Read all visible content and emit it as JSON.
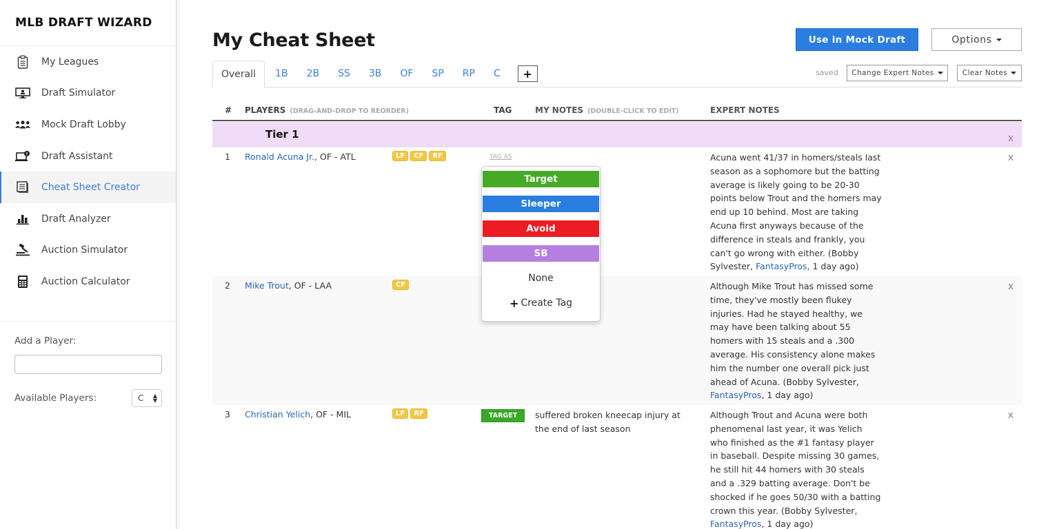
{
  "app": {
    "title": "MLB DRAFT WIZARD"
  },
  "sidebar": {
    "items": [
      {
        "label": "My Leagues",
        "icon": "clipboard-icon",
        "active": false
      },
      {
        "label": "Draft Simulator",
        "icon": "monitor-user-icon",
        "active": false
      },
      {
        "label": "Mock Draft Lobby",
        "icon": "users-group-icon",
        "active": false
      },
      {
        "label": "Draft Assistant",
        "icon": "laptop-alert-icon",
        "active": false
      },
      {
        "label": "Cheat Sheet Creator",
        "icon": "document-list-icon",
        "active": true
      },
      {
        "label": "Draft Analyzer",
        "icon": "bar-chart-icon",
        "active": false
      },
      {
        "label": "Auction Simulator",
        "icon": "gavel-icon",
        "active": false
      },
      {
        "label": "Auction Calculator",
        "icon": "calculator-icon",
        "active": false
      }
    ],
    "add_player_label": "Add a Player:",
    "add_player_value": "",
    "available_players_label": "Available Players:",
    "available_players_selected": "C"
  },
  "header": {
    "title": "My Cheat Sheet",
    "use_in_mock_label": "Use in Mock Draft",
    "options_label": "Options",
    "saved_status": "saved",
    "change_expert_notes_label": "Change Expert Notes",
    "clear_notes_label": "Clear Notes"
  },
  "tabs": [
    {
      "label": "Overall",
      "active": true
    },
    {
      "label": "1B"
    },
    {
      "label": "2B"
    },
    {
      "label": "SS"
    },
    {
      "label": "3B"
    },
    {
      "label": "OF"
    },
    {
      "label": "SP"
    },
    {
      "label": "RP"
    },
    {
      "label": "C"
    }
  ],
  "tab_add_label": "+",
  "table": {
    "columns": {
      "num": "#",
      "players": "PLAYERS",
      "players_hint": "(DRAG-AND-DROP TO REORDER)",
      "tag": "TAG",
      "my_notes": "MY NOTES",
      "my_notes_hint": "(DOUBLE-CLICK TO EDIT)",
      "expert_notes": "EXPERT NOTES"
    },
    "tier": {
      "label": "Tier 1",
      "remove": "x"
    },
    "rows": [
      {
        "rank": "1",
        "name": "Ronald Acuna Jr.",
        "info": ", OF - ATL",
        "positions": [
          "LF",
          "CF",
          "RF"
        ],
        "tag": "TAG AS",
        "my_notes": "",
        "expert_text": "Acuna went 41/37 in homers/steals last season as a sophomore but the batting average is likely going to be 20-30 points below Trout and the homers may end up 10 behind. Most are taking Acuna first anyways because of the difference in steals and frankly, you can't go wrong with either. (Bobby Sylvester, ",
        "expert_source": "FantasyPros",
        "expert_suffix": ", 1 day ago)",
        "remove": "x"
      },
      {
        "rank": "2",
        "name": "Mike Trout",
        "info": ", OF - LAA",
        "positions": [
          "CF"
        ],
        "tag": "",
        "my_notes": "",
        "expert_text": "Although Mike Trout has missed some time, they've mostly been flukey injuries. Had he stayed healthy, we may have been talking about 55 homers with 15 steals and a .300 average. His consistency alone makes him the number one overall pick just ahead of Acuna. (Bobby Sylvester, ",
        "expert_source": "FantasyPros",
        "expert_suffix": ", 1 day ago)",
        "remove": "x"
      },
      {
        "rank": "3",
        "name": "Christian Yelich",
        "info": ", OF - MIL",
        "positions": [
          "LF",
          "RF"
        ],
        "tag": "TARGET",
        "my_notes": "suffered broken kneecap injury at the end of last season",
        "expert_text": "Although Trout and Acuna were both phenomenal last year, it was Yelich who finished as the #1 fantasy player in baseball. Despite missing 30 games, he still hit 44 homers with 30 steals and a .329 batting average. Don't be shocked if he goes 50/30 with a batting crown this year. (Bobby Sylvester, ",
        "expert_source": "FantasyPros",
        "expert_suffix": ", 1 day ago)",
        "remove": "x"
      }
    ]
  },
  "tag_menu": {
    "options": [
      {
        "label": "Target",
        "color": "#45ab27"
      },
      {
        "label": "Sleeper",
        "color": "#2a7de1"
      },
      {
        "label": "Avoid",
        "color": "#ec1c24"
      },
      {
        "label": "SB",
        "color": "#b57fe0"
      }
    ],
    "none_label": "None",
    "create_label": "Create Tag"
  },
  "colors": {
    "accent": "#2a7de1",
    "link": "#2a66b8",
    "tier_bg": "#f0dcf8",
    "position_badge": "#f3c744"
  }
}
